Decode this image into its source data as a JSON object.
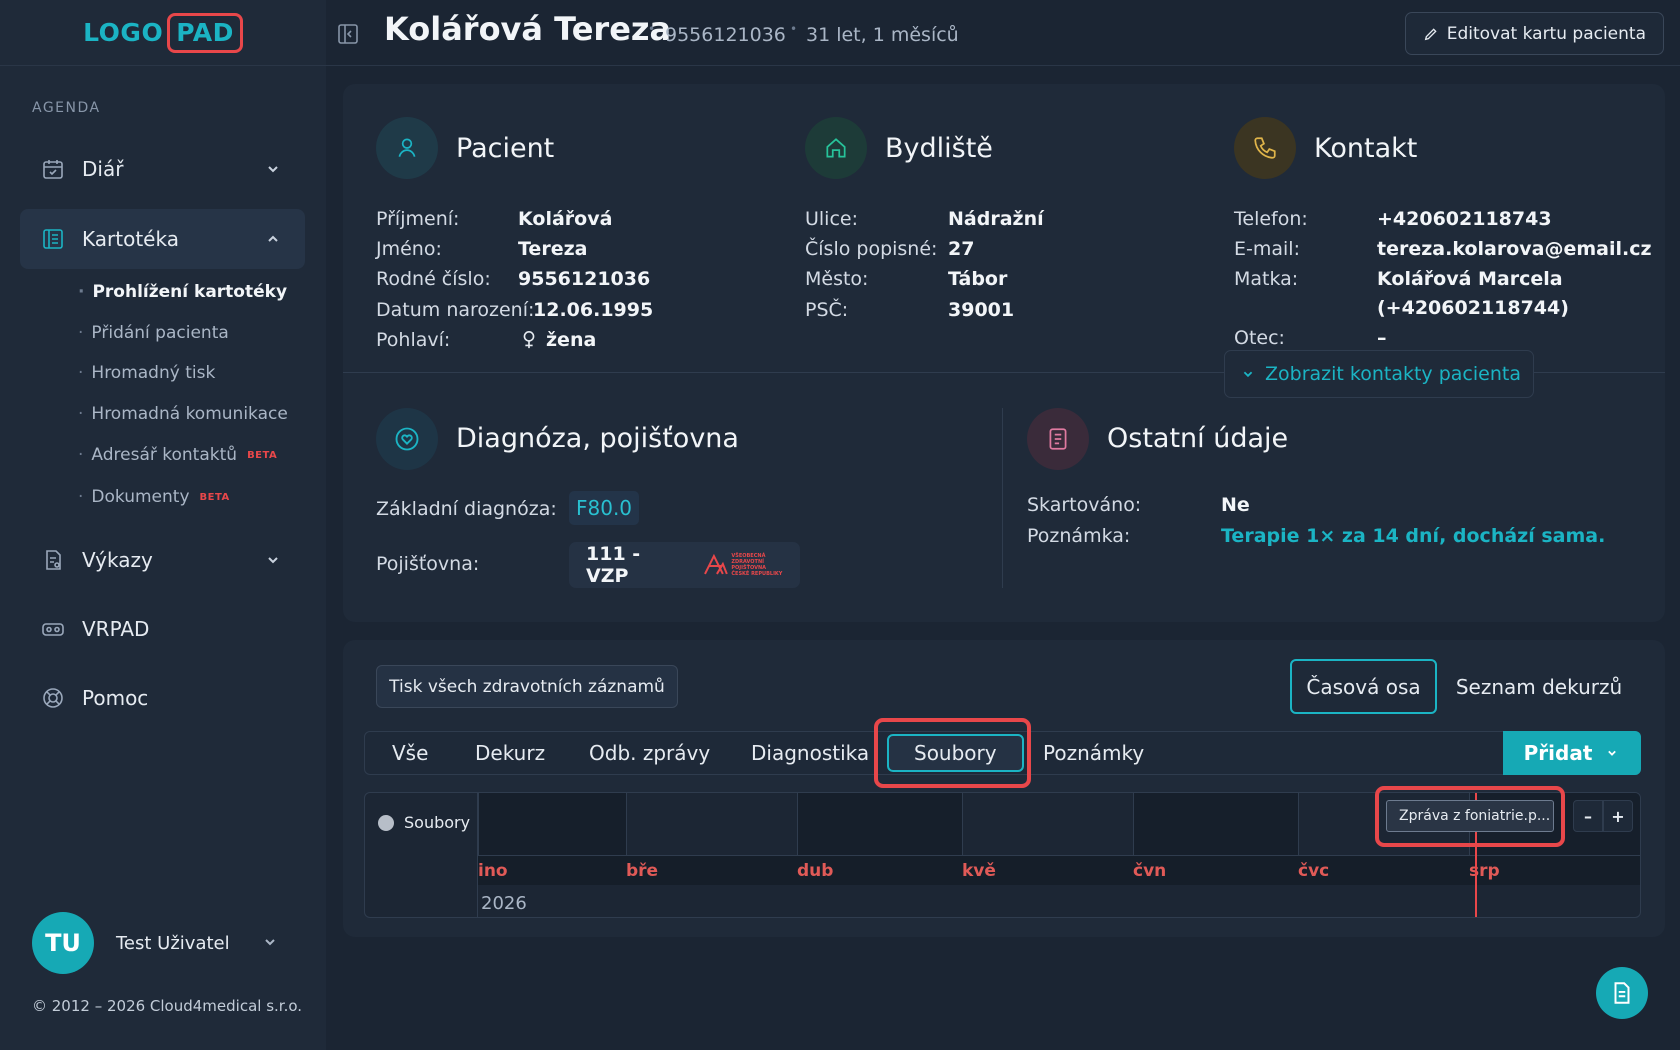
{
  "logo": {
    "part1": "LOGO",
    "part2": "PAD"
  },
  "sidebar": {
    "section_label": "AGENDA",
    "items": [
      {
        "label": "Diář",
        "icon": "calendar-icon"
      },
      {
        "label": "Kartotéka",
        "icon": "file-cabinet-icon"
      },
      {
        "label": "Výkazy",
        "icon": "report-icon"
      },
      {
        "label": "VRPAD",
        "icon": "vr-headset-icon"
      },
      {
        "label": "Pomoc",
        "icon": "lifebuoy-icon"
      }
    ],
    "subitems": [
      {
        "label": "Prohlížení kartotéky"
      },
      {
        "label": "Přidání pacienta"
      },
      {
        "label": "Hromadný tisk"
      },
      {
        "label": "Hromadná komunikace"
      },
      {
        "label": "Adresář kontaktů",
        "badge": "BETA"
      },
      {
        "label": "Dokumenty",
        "badge": "BETA"
      }
    ]
  },
  "user": {
    "initials": "TU",
    "name": "Test Uživatel"
  },
  "footer": {
    "copyright": "© 2012 – 2026 Cloud4medical s.r.o."
  },
  "header": {
    "title": "Kolářová Tereza",
    "birth_number": "9556121036",
    "age": "31 let, 1 měsíců",
    "edit_button": "Editovat kartu pacienta"
  },
  "patient": {
    "title": "Pacient",
    "fields": [
      {
        "label": "Příjmení:",
        "value": "Kolářová"
      },
      {
        "label": "Jméno:",
        "value": "Tereza"
      },
      {
        "label": "Rodné číslo:",
        "value": "9556121036"
      },
      {
        "label": "Datum narození:",
        "value": "12.06.1995"
      },
      {
        "label": "Pohlaví:",
        "value": "žena"
      }
    ]
  },
  "residence": {
    "title": "Bydliště",
    "fields": [
      {
        "label": "Ulice:",
        "value": "Nádražní"
      },
      {
        "label": "Číslo popisné:",
        "value": "27"
      },
      {
        "label": "Město:",
        "value": "Tábor"
      },
      {
        "label": "PSČ:",
        "value": "39001"
      }
    ]
  },
  "contact": {
    "title": "Kontakt",
    "fields": [
      {
        "label": "Telefon:",
        "value": "+420602118743"
      },
      {
        "label": "E-mail:",
        "value": "tereza.kolarova@email.cz"
      },
      {
        "label": "Matka:",
        "value": "Kolářová Marcela",
        "value2": "(+420602118744)"
      },
      {
        "label": "Otec:",
        "value": "–"
      }
    ],
    "show_contacts": "Zobrazit kontakty pacienta"
  },
  "diagnosis": {
    "title": "Diagnóza, pojišťovna",
    "diag_label": "Základní diagnóza:",
    "diag_value": "F80.0",
    "ins_label": "Pojišťovna:",
    "ins_value": "111 - VZP",
    "ins_logo_text": [
      "VŠEOBECNÁ",
      "ZDRAVOTNÍ POJIŠŤOVNA",
      "ČESKÉ REPUBLIKY"
    ]
  },
  "other": {
    "title": "Ostatní údaje",
    "fields": [
      {
        "label": "Skartováno:",
        "value": "Ne"
      },
      {
        "label": "Poznámka:",
        "value": "Terapie 1× za 14 dní, dochází sama."
      }
    ]
  },
  "records": {
    "print_all": "Tisk všech zdravotních záznamů",
    "views": [
      "Časová osa",
      "Seznam dekurzů"
    ],
    "active_view": "Časová osa",
    "tabs": [
      "Vše",
      "Dekurz",
      "Odb. zprávy",
      "Diagnostika",
      "Soubory",
      "Poznámky"
    ],
    "active_tab": "Soubory",
    "add_button": "Přidat"
  },
  "timeline": {
    "group": "Soubory",
    "months": [
      "ino",
      "bře",
      "dub",
      "kvě",
      "čvn",
      "čvc",
      "srp"
    ],
    "year": "2026",
    "item": "Zpráva z foniatrie.p...",
    "zoom_out": "–",
    "zoom_in": "+"
  },
  "colors": {
    "accent": "#16a9b5",
    "highlight": "#e8474a",
    "background": "#1b2533"
  }
}
